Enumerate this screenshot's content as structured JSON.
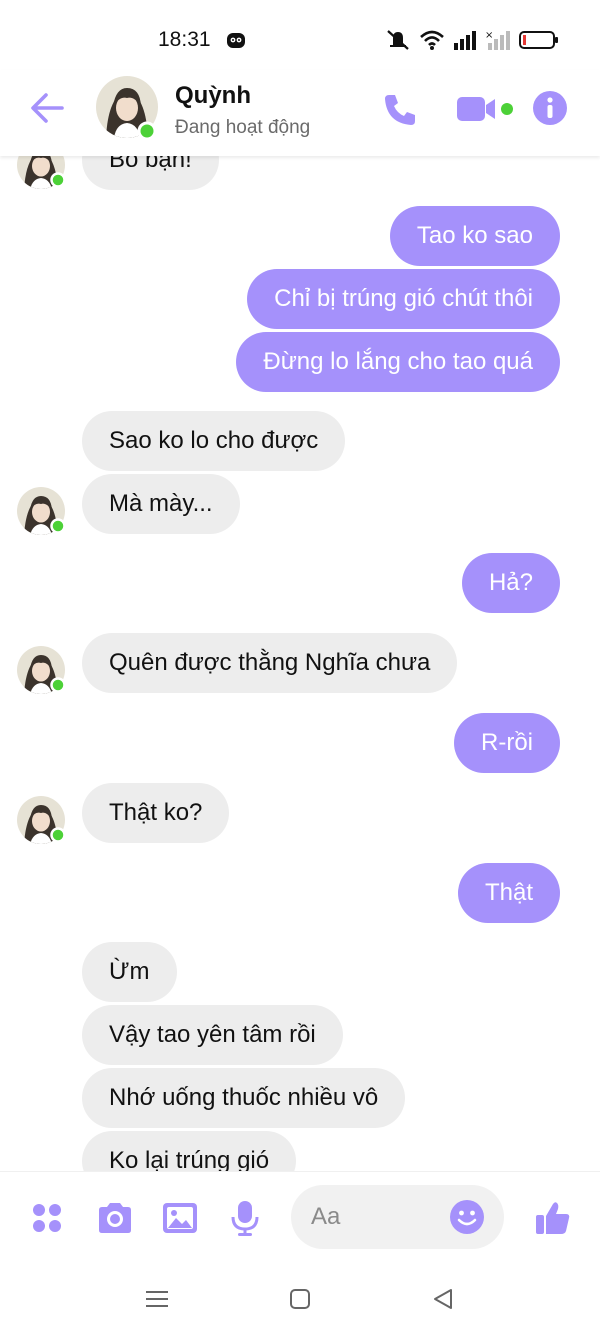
{
  "status_bar": {
    "time": "18:31"
  },
  "header": {
    "name": "Quỳnh",
    "status": "Đang hoạt động",
    "accent_color": "#a591fb",
    "online_color": "#4cd137"
  },
  "messages": [
    {
      "dir": "in",
      "text": "Bỏ bạn!"
    },
    {
      "dir": "out",
      "text": "Tao ko sao"
    },
    {
      "dir": "out",
      "text": "Chỉ bị trúng gió chút thôi"
    },
    {
      "dir": "out",
      "text": "Đừng lo lắng cho tao quá"
    },
    {
      "dir": "in",
      "text": "Sao ko lo cho được"
    },
    {
      "dir": "in",
      "text": "Mà mày..."
    },
    {
      "dir": "out",
      "text": "Hả?"
    },
    {
      "dir": "in",
      "text": "Quên được thằng Nghĩa chưa"
    },
    {
      "dir": "out",
      "text": "R-rồi"
    },
    {
      "dir": "in",
      "text": "Thật ko?"
    },
    {
      "dir": "out",
      "text": "Thật"
    },
    {
      "dir": "in",
      "text": "Ừm"
    },
    {
      "dir": "in",
      "text": "Vậy tao yên tâm rồi"
    },
    {
      "dir": "in",
      "text": "Nhớ uống thuốc nhiều vô"
    },
    {
      "dir": "in",
      "text": "Ko lại trúng gió"
    }
  ],
  "composer": {
    "placeholder": "Aa"
  },
  "icons": {
    "back": "arrow-left-icon",
    "call": "phone-icon",
    "video": "video-camera-icon",
    "info": "info-icon",
    "menu": "four-dots-icon",
    "camera": "camera-icon",
    "gallery": "image-icon",
    "mic": "microphone-icon",
    "emoji": "smiley-icon",
    "like": "thumbs-up-icon"
  }
}
